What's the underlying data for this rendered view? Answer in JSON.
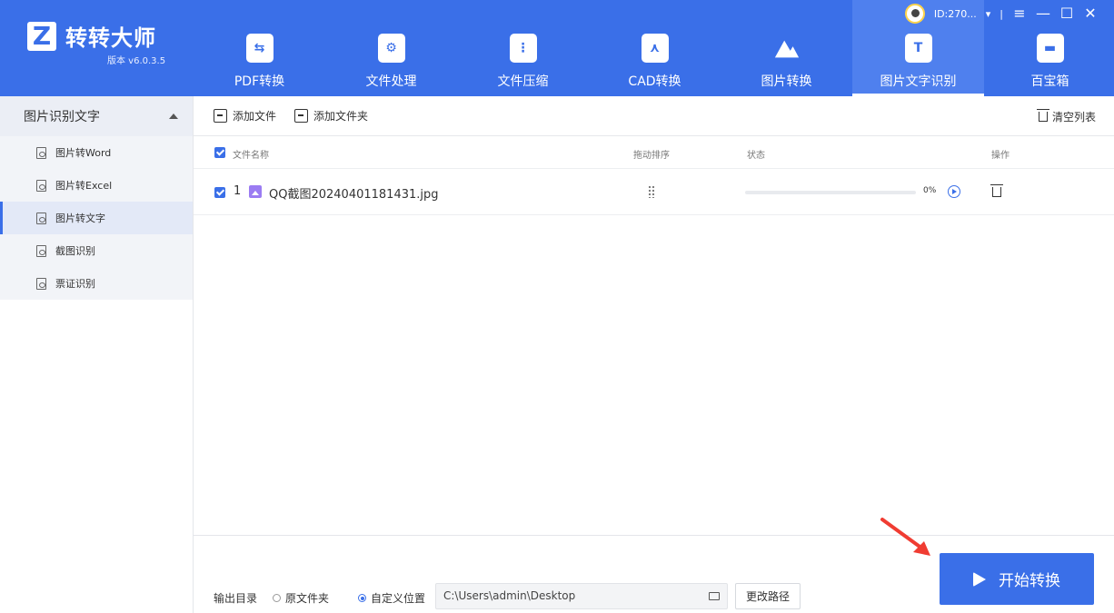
{
  "app": {
    "name": "转转大师",
    "version": "版本 v6.0.3.5"
  },
  "nav": {
    "items": [
      {
        "label": "PDF转换",
        "icon": "pdf-icon"
      },
      {
        "label": "文件处理",
        "icon": "file-process-icon"
      },
      {
        "label": "文件压缩",
        "icon": "zip-icon"
      },
      {
        "label": "CAD转换",
        "icon": "cad-icon"
      },
      {
        "label": "图片转换",
        "icon": "image-icon"
      },
      {
        "label": "图片文字识别",
        "icon": "text-recognition-icon"
      },
      {
        "label": "百宝箱",
        "icon": "toolbox-icon"
      }
    ],
    "active_index": 5
  },
  "user": {
    "id": "ID:270...",
    "dropdown": "▾",
    "sep": "|"
  },
  "window": {
    "menu": "≡",
    "minimize": "—",
    "maximize": "☐",
    "close": "✕"
  },
  "sidebar": {
    "section_title": "图片识别文字",
    "items": [
      {
        "label": "图片转Word"
      },
      {
        "label": "图片转Excel"
      },
      {
        "label": "图片转文字"
      },
      {
        "label": "截图识别"
      },
      {
        "label": "票证识别"
      }
    ],
    "active_index": 2
  },
  "toolbar": {
    "add_file": "添加文件",
    "add_folder": "添加文件夹",
    "clear_list": "清空列表"
  },
  "table": {
    "columns": {
      "name": "文件名称",
      "sort": "拖动排序",
      "status": "状态",
      "action": "操作"
    },
    "rows": [
      {
        "index": "1",
        "filename": "QQ截图20240401181431.jpg",
        "progress_percent": 0,
        "progress_text": "0%"
      }
    ]
  },
  "output": {
    "label": "输出目录",
    "option_original": "原文件夹",
    "option_custom": "自定义位置",
    "selected": "custom",
    "path": "C:\\Users\\admin\\Desktop",
    "change_button": "更改路径"
  },
  "start_button": "开始转换",
  "colors": {
    "primary": "#3a6fe8",
    "arrow": "#f03c32"
  }
}
